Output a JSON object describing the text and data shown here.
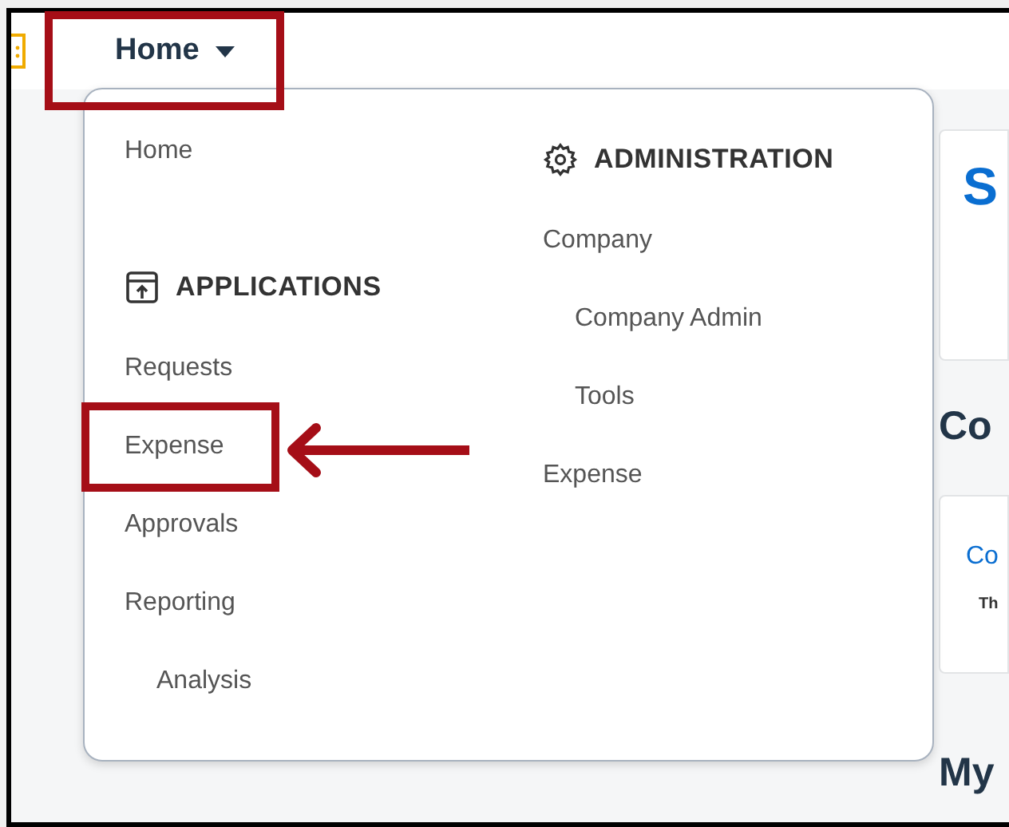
{
  "nav": {
    "label": "Home",
    "expanded": true
  },
  "menu": {
    "columns": [
      {
        "entries": [
          {
            "kind": "link",
            "label": "Home"
          },
          {
            "kind": "section",
            "label": "APPLICATIONS"
          },
          {
            "kind": "link",
            "label": "Requests"
          },
          {
            "kind": "link",
            "label": "Expense",
            "highlighted": true
          },
          {
            "kind": "link",
            "label": "Approvals"
          },
          {
            "kind": "link",
            "label": "Reporting",
            "children": [
              {
                "kind": "link",
                "label": "Analysis"
              }
            ]
          }
        ]
      },
      {
        "entries": [
          {
            "kind": "section",
            "label": "ADMINISTRATION"
          },
          {
            "kind": "link",
            "label": "Company",
            "children": [
              {
                "kind": "link",
                "label": "Company Admin"
              },
              {
                "kind": "link",
                "label": "Tools"
              }
            ]
          },
          {
            "kind": "link",
            "label": "Expense"
          }
        ]
      }
    ]
  },
  "background": {
    "card_title": "S",
    "section_heading": "Co",
    "card_link": "Co",
    "card_text": "Th",
    "bottom_heading": "My"
  }
}
